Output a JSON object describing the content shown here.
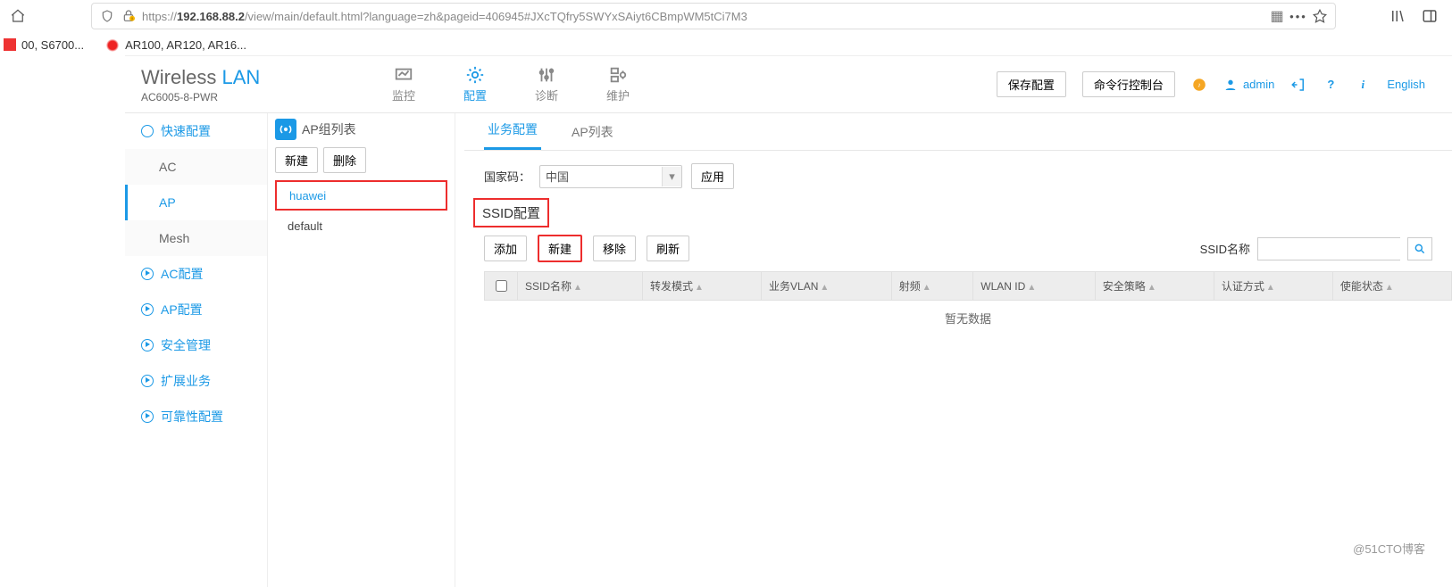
{
  "browser": {
    "url_prefix": "https://",
    "url_bold": "192.168.88.2",
    "url_rest": "/view/main/default.html?language=zh&pageid=406945#JXcTQfry5SWYxSAiyt6CBmpWM5tCi7M3"
  },
  "bookmarks": {
    "b0": "00, S6700...",
    "b1": "AR100, AR120, AR16..."
  },
  "brand": {
    "wireless": "Wireless ",
    "lan": "LAN",
    "model": "AC6005-8-PWR"
  },
  "mainnav": {
    "monitor": "监控",
    "config": "配置",
    "diag": "诊断",
    "maint": "维护"
  },
  "header_right": {
    "save": "保存配置",
    "cli": "命令行控制台",
    "user": "admin",
    "lang": "English"
  },
  "sidebar": {
    "quick": "快速配置",
    "ac": "AC",
    "ap": "AP",
    "mesh": "Mesh",
    "ac_cfg": "AC配置",
    "ap_cfg": "AP配置",
    "sec": "安全管理",
    "ext": "扩展业务",
    "rel": "可靠性配置"
  },
  "middle": {
    "title": "AP组列表",
    "new": "新建",
    "del": "删除",
    "g0": "huawei",
    "g1": "default"
  },
  "tabs": {
    "service": "业务配置",
    "aplist": "AP列表"
  },
  "cc": {
    "label": "国家码：",
    "value": "中国",
    "apply": "应用"
  },
  "ssid": {
    "title": "SSID配置",
    "add": "添加",
    "new": "新建",
    "remove": "移除",
    "refresh": "刷新",
    "search_label": "SSID名称"
  },
  "cols": {
    "c0": "SSID名称",
    "c1": "转发模式",
    "c2": "业务VLAN",
    "c3": "射频",
    "c4": "WLAN ID",
    "c5": "安全策略",
    "c6": "认证方式",
    "c7": "使能状态"
  },
  "table_empty": "暂无数据",
  "watermark": "@51CTO博客"
}
